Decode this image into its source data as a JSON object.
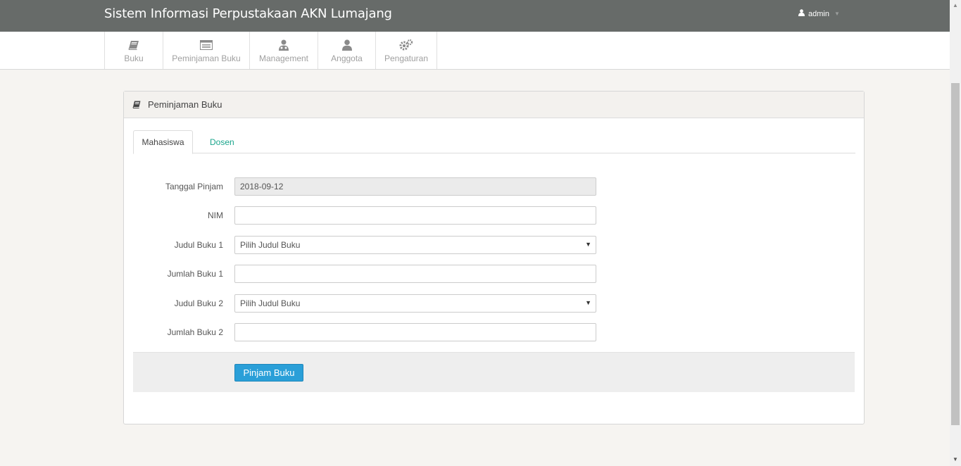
{
  "header": {
    "title": "Sistem Informasi Perpustakaan AKN Lumajang",
    "user": "admin"
  },
  "nav": {
    "items": [
      {
        "label": "Buku",
        "icon": "book-icon"
      },
      {
        "label": "Peminjaman Buku",
        "icon": "list-icon"
      },
      {
        "label": "Management",
        "icon": "users-icon"
      },
      {
        "label": "Anggota",
        "icon": "user-icon"
      },
      {
        "label": "Pengaturan",
        "icon": "gears-icon"
      }
    ]
  },
  "panel": {
    "title": "Peminjaman Buku",
    "tabs": [
      {
        "label": "Mahasiswa",
        "active": true
      },
      {
        "label": "Dosen",
        "active": false
      }
    ],
    "form": {
      "tanggal_label": "Tanggal Pinjam",
      "tanggal_value": "2018-09-12",
      "nim_label": "NIM",
      "nim_value": "",
      "judul1_label": "Judul Buku 1",
      "judul1_value": "Pilih Judul Buku",
      "jumlah1_label": "Jumlah Buku 1",
      "jumlah1_value": "",
      "judul2_label": "Judul Buku 2",
      "judul2_value": "Pilih Judul Buku",
      "jumlah2_label": "Jumlah Buku 2",
      "jumlah2_value": ""
    },
    "submit_label": "Pinjam Buku"
  },
  "colors": {
    "topbar": "#676b69",
    "accent": "#2a9fd8",
    "tab_link": "#1aa58c"
  }
}
